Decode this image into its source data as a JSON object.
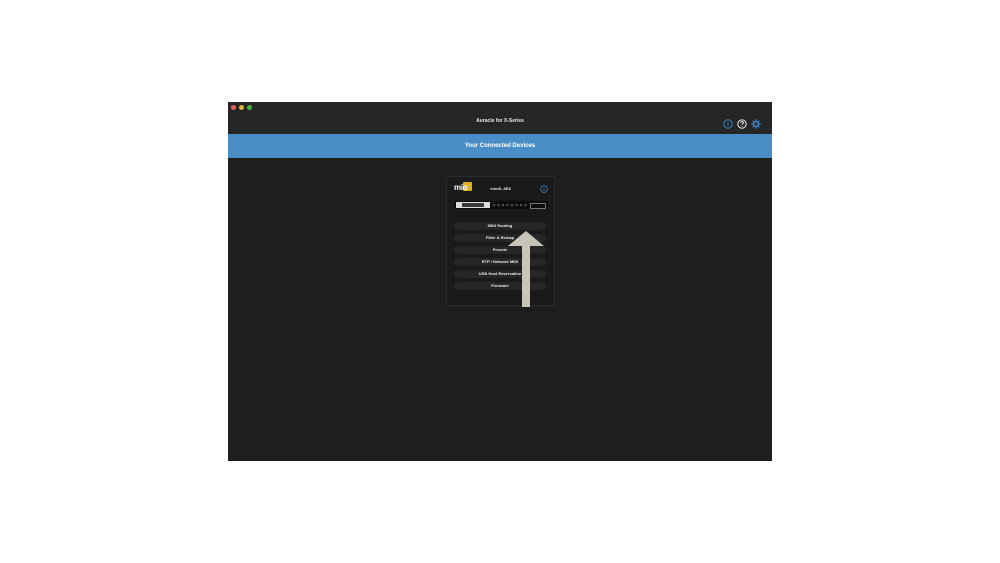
{
  "window": {
    "title": "Auracle for X-Series"
  },
  "header_icons": [
    "info-icon",
    "help-icon",
    "gear-icon"
  ],
  "banner": {
    "title": "Your Connected Devices"
  },
  "device": {
    "name": "mioXL 8E8",
    "logo_text": "mio",
    "menu": [
      "MIDI Routing",
      "Filter & Remap",
      "Presets",
      "RTP / Network MIDI",
      "USB Host Reservation",
      "Firmware"
    ]
  },
  "colors": {
    "banner": "#4a8ec8",
    "accent_blue": "#3d8fd6",
    "window_bg": "#1e1e1e",
    "logo_gold": "#e0b21e",
    "arrow": "#c9c4b8"
  }
}
